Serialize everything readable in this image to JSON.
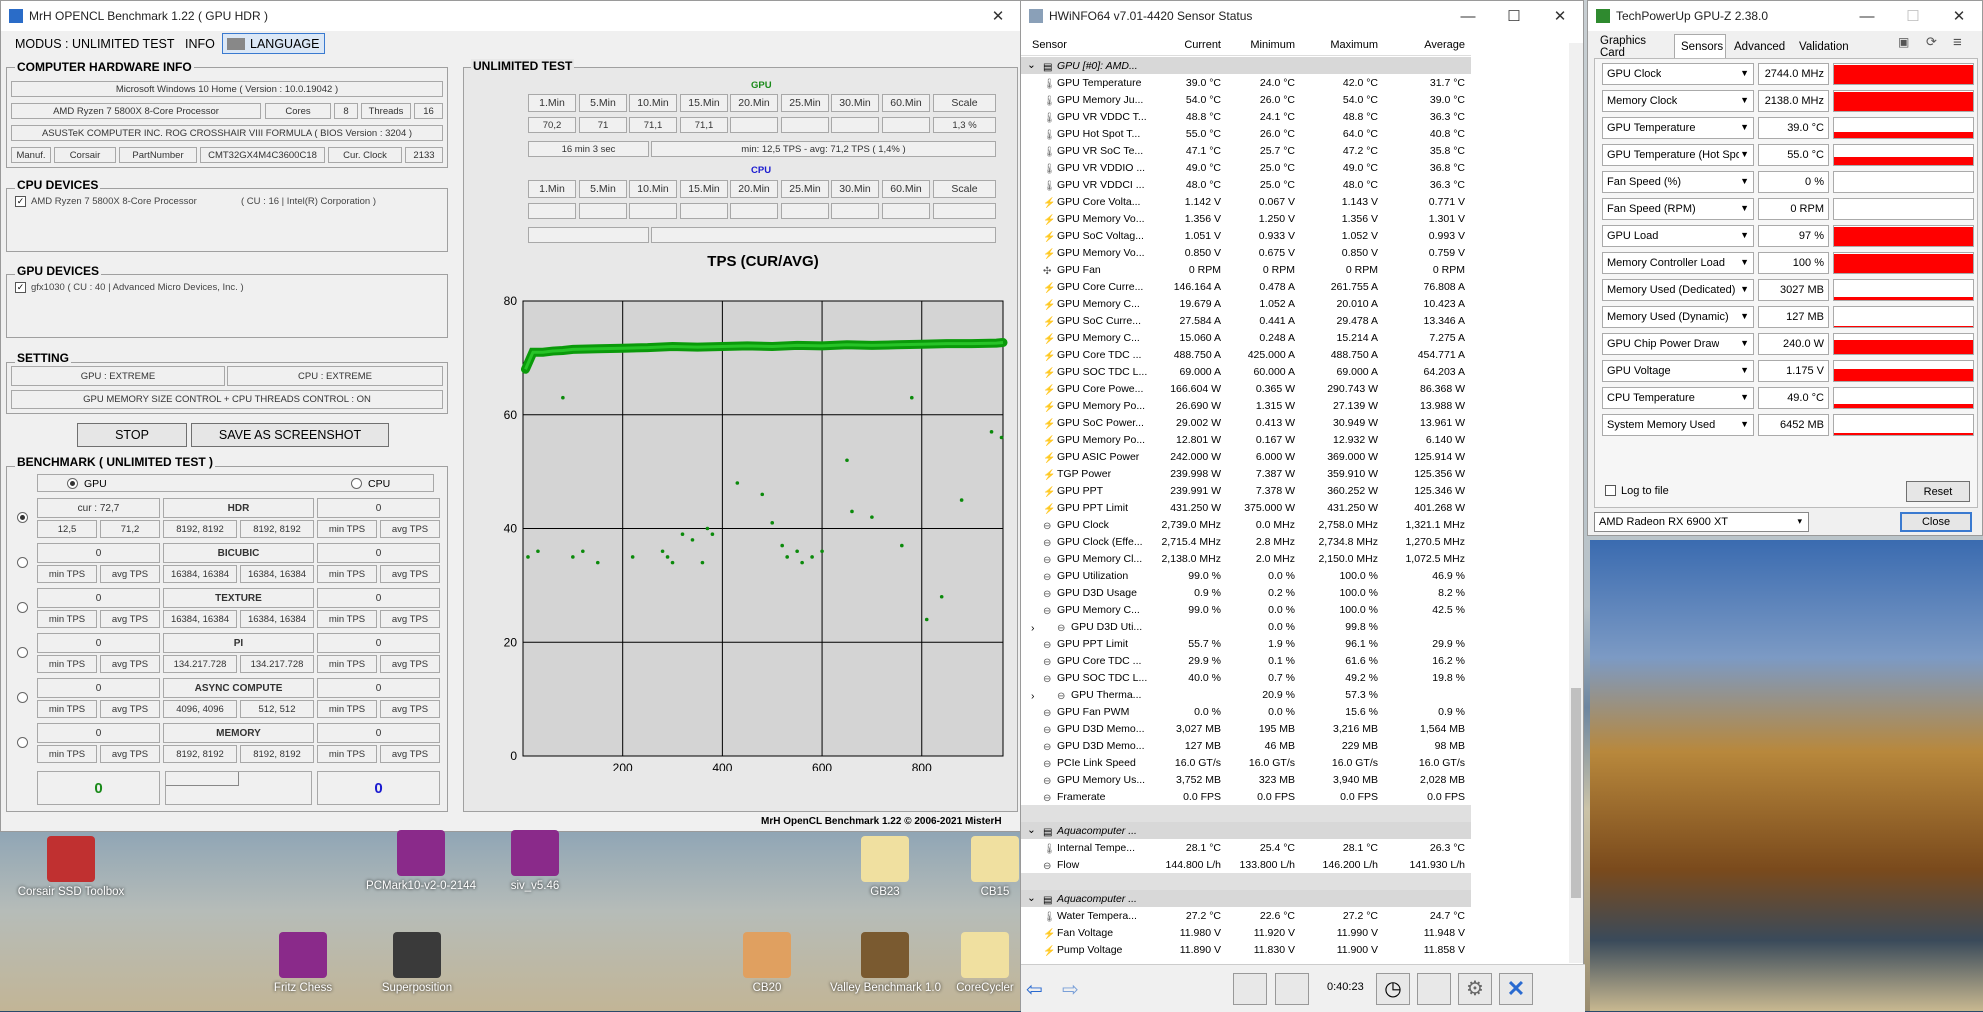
{
  "mrh": {
    "title": "MrH OPENCL Benchmark 1.22 ( GPU HDR )",
    "menu": {
      "modus": "MODUS : UNLIMITED TEST",
      "info": "INFO",
      "language": "LANGUAGE"
    },
    "hw_info": {
      "title": "COMPUTER HARDWARE INFO",
      "os": "Microsoft Windows 10 Home ( Version : 10.0.19042 )",
      "cpu": "AMD Ryzen 7 5800X 8-Core Processor",
      "cores_label": "Cores",
      "cores": "8",
      "threads_label": "Threads",
      "threads": "16",
      "board": "ASUSTeK COMPUTER INC. ROG CROSSHAIR VIII FORMULA ( BIOS Version : 3204 )",
      "manuf_label": "Manuf.",
      "manuf": "Corsair",
      "part_label": "PartNumber",
      "part": "CMT32GX4M4C3600C18",
      "clock_label": "Cur. Clock",
      "clock": "2133"
    },
    "cpu_devices": {
      "title": "CPU DEVICES",
      "item": "AMD Ryzen 7 5800X 8-Core Processor",
      "item2": "( CU : 16 | Intel(R) Corporation )"
    },
    "gpu_devices": {
      "title": "GPU DEVICES",
      "item": "gfx1030 ( CU : 40 | Advanced Micro Devices, Inc. )"
    },
    "setting": {
      "title": "SETTING",
      "gpu": "GPU : EXTREME",
      "cpu": "CPU : EXTREME",
      "control": "GPU MEMORY SIZE CONTROL + CPU THREADS CONTROL : ON"
    },
    "stop": "STOP",
    "save": "SAVE AS SCREENSHOT",
    "benchmark": {
      "title": "BENCHMARK ( UNLIMITED TEST )",
      "gpu": "GPU",
      "cpu": "CPU",
      "rows": [
        {
          "left": "cur : 72,7",
          "l1": "12,5",
          "l2": "71,2",
          "name": "HDR",
          "c1": "8192, 8192",
          "c2": "8192, 8192",
          "right": "0",
          "r1": "min TPS",
          "r2": "avg TPS"
        },
        {
          "left": "0",
          "l1": "min TPS",
          "l2": "avg TPS",
          "name": "BICUBIC",
          "c1": "16384, 16384",
          "c2": "16384, 16384",
          "right": "0",
          "r1": "min TPS",
          "r2": "avg TPS"
        },
        {
          "left": "0",
          "l1": "min TPS",
          "l2": "avg TPS",
          "name": "TEXTURE",
          "c1": "16384, 16384",
          "c2": "16384, 16384",
          "right": "0",
          "r1": "min TPS",
          "r2": "avg TPS"
        },
        {
          "left": "0",
          "l1": "min TPS",
          "l2": "avg TPS",
          "name": "PI",
          "c1": "134.217.728",
          "c2": "134.217.728",
          "right": "0",
          "r1": "min TPS",
          "r2": "avg TPS"
        },
        {
          "left": "0",
          "l1": "min TPS",
          "l2": "avg TPS",
          "name": "ASYNC COMPUTE",
          "c1": "4096, 4096",
          "c2": "512, 512",
          "right": "0",
          "r1": "min TPS",
          "r2": "avg TPS"
        },
        {
          "left": "0",
          "l1": "min TPS",
          "l2": "avg TPS",
          "name": "MEMORY",
          "c1": "8192, 8192",
          "c2": "8192, 8192",
          "right": "0",
          "r1": "min TPS",
          "r2": "avg TPS"
        }
      ],
      "score_gpu": "0",
      "score_cpu": "0"
    },
    "unlimited": {
      "title": "UNLIMITED TEST",
      "gpu_label": "GPU",
      "cpu_label": "CPU",
      "cols": [
        "1.Min",
        "5.Min",
        "10.Min",
        "15.Min",
        "20.Min",
        "25.Min",
        "30.Min",
        "60.Min",
        "Scale"
      ],
      "gpu_vals": [
        "70,2",
        "71",
        "71,1",
        "71,1",
        "",
        "",
        "",
        "",
        "1,3 %"
      ],
      "gpu_time": "16 min 3 sec",
      "gpu_summary": "min: 12,5 TPS - avg: 71,2 TPS ( 1,4% )"
    },
    "footer": "MrH OpenCL Benchmark 1.22  ©  2006-2021 MisterH"
  },
  "chart_data": {
    "type": "scatter",
    "title": "TPS (CUR/AVG)",
    "ylim": [
      0,
      80
    ],
    "xlim": [
      0,
      963
    ],
    "yticks": [
      0,
      20,
      40,
      60,
      80
    ],
    "xticks": [
      200,
      400,
      600,
      800
    ],
    "grid": true,
    "series": [
      {
        "values_note": "",
        "x": [
          5,
          20,
          40,
          60,
          80,
          100,
          150,
          200,
          250,
          300,
          350,
          400,
          450,
          500,
          550,
          600,
          650,
          700,
          750,
          800,
          850,
          900,
          950,
          963
        ],
        "y": [
          68,
          71,
          71,
          71.2,
          71.3,
          71.5,
          71.6,
          71.7,
          71.8,
          72,
          71.9,
          72,
          72.1,
          72,
          72.2,
          72.1,
          72.3,
          72.2,
          72.3,
          72.4,
          72.5,
          72.5,
          72.6,
          72.7
        ]
      },
      {
        "x": [
          10,
          30,
          80,
          100,
          120,
          150,
          220,
          280,
          290,
          300,
          320,
          340,
          360,
          370,
          380,
          430,
          480,
          500,
          520,
          530,
          550,
          560,
          580,
          600,
          650,
          660,
          700,
          760,
          780,
          810,
          840,
          880,
          940,
          960
        ],
        "y": [
          35,
          36,
          63,
          35,
          36,
          34,
          35,
          36,
          35,
          34,
          39,
          38,
          34,
          40,
          39,
          48,
          46,
          41,
          37,
          35,
          36,
          34,
          35,
          36,
          52,
          43,
          42,
          37,
          63,
          24,
          28,
          45,
          57,
          56
        ]
      }
    ]
  },
  "hwinfo": {
    "title": "HWiNFO64 v7.01-4420 Sensor Status",
    "headers": [
      "Sensor",
      "Current",
      "Minimum",
      "Maximum",
      "Average"
    ],
    "rows": [
      {
        "t": "section",
        "n": "GPU [#0]: AMD..."
      },
      {
        "i": "temp",
        "n": "GPU Temperature",
        "c": "39.0 °C",
        "mn": "24.0 °C",
        "mx": "42.0 °C",
        "a": "31.7 °C"
      },
      {
        "i": "temp",
        "n": "GPU Memory Ju...",
        "c": "54.0 °C",
        "mn": "26.0 °C",
        "mx": "54.0 °C",
        "a": "39.0 °C"
      },
      {
        "i": "temp",
        "n": "GPU VR VDDC T...",
        "c": "48.8 °C",
        "mn": "24.1 °C",
        "mx": "48.8 °C",
        "a": "36.3 °C"
      },
      {
        "i": "temp",
        "n": "GPU Hot Spot T...",
        "c": "55.0 °C",
        "mn": "26.0 °C",
        "mx": "64.0 °C",
        "a": "40.8 °C"
      },
      {
        "i": "temp",
        "n": "GPU VR SoC Te...",
        "c": "47.1 °C",
        "mn": "25.7 °C",
        "mx": "47.2 °C",
        "a": "35.8 °C"
      },
      {
        "i": "temp",
        "n": "GPU VR VDDIO ...",
        "c": "49.0 °C",
        "mn": "25.0 °C",
        "mx": "49.0 °C",
        "a": "36.8 °C"
      },
      {
        "i": "temp",
        "n": "GPU VR VDDCI ...",
        "c": "48.0 °C",
        "mn": "25.0 °C",
        "mx": "48.0 °C",
        "a": "36.3 °C"
      },
      {
        "i": "volt",
        "n": "GPU Core Volta...",
        "c": "1.142 V",
        "mn": "0.067 V",
        "mx": "1.143 V",
        "a": "0.771 V"
      },
      {
        "i": "volt",
        "n": "GPU Memory Vo...",
        "c": "1.356 V",
        "mn": "1.250 V",
        "mx": "1.356 V",
        "a": "1.301 V"
      },
      {
        "i": "volt",
        "n": "GPU SoC Voltag...",
        "c": "1.051 V",
        "mn": "0.933 V",
        "mx": "1.052 V",
        "a": "0.993 V"
      },
      {
        "i": "volt",
        "n": "GPU Memory Vo...",
        "c": "0.850 V",
        "mn": "0.675 V",
        "mx": "0.850 V",
        "a": "0.759 V"
      },
      {
        "i": "fan",
        "n": "GPU Fan",
        "c": "0 RPM",
        "mn": "0 RPM",
        "mx": "0 RPM",
        "a": "0 RPM"
      },
      {
        "i": "volt",
        "n": "GPU Core Curre...",
        "c": "146.164 A",
        "mn": "0.478 A",
        "mx": "261.755 A",
        "a": "76.808 A"
      },
      {
        "i": "volt",
        "n": "GPU Memory C...",
        "c": "19.679 A",
        "mn": "1.052 A",
        "mx": "20.010 A",
        "a": "10.423 A"
      },
      {
        "i": "volt",
        "n": "GPU SoC Curre...",
        "c": "27.584 A",
        "mn": "0.441 A",
        "mx": "29.478 A",
        "a": "13.346 A"
      },
      {
        "i": "volt",
        "n": "GPU Memory C...",
        "c": "15.060 A",
        "mn": "0.248 A",
        "mx": "15.214 A",
        "a": "7.275 A"
      },
      {
        "i": "volt",
        "n": "GPU Core TDC ...",
        "c": "488.750 A",
        "mn": "425.000 A",
        "mx": "488.750 A",
        "a": "454.771 A"
      },
      {
        "i": "volt",
        "n": "GPU SOC TDC L...",
        "c": "69.000 A",
        "mn": "60.000 A",
        "mx": "69.000 A",
        "a": "64.203 A"
      },
      {
        "i": "volt",
        "n": "GPU Core Powe...",
        "c": "166.604 W",
        "mn": "0.365 W",
        "mx": "290.743 W",
        "a": "86.368 W"
      },
      {
        "i": "volt",
        "n": "GPU Memory Po...",
        "c": "26.690 W",
        "mn": "1.315 W",
        "mx": "27.139 W",
        "a": "13.988 W"
      },
      {
        "i": "volt",
        "n": "GPU SoC Power...",
        "c": "29.002 W",
        "mn": "0.413 W",
        "mx": "30.949 W",
        "a": "13.961 W"
      },
      {
        "i": "volt",
        "n": "GPU Memory Po...",
        "c": "12.801 W",
        "mn": "0.167 W",
        "mx": "12.932 W",
        "a": "6.140 W"
      },
      {
        "i": "volt",
        "n": "GPU ASIC Power",
        "c": "242.000 W",
        "mn": "6.000 W",
        "mx": "369.000 W",
        "a": "125.914 W"
      },
      {
        "i": "volt",
        "n": "TGP Power",
        "c": "239.998 W",
        "mn": "7.387 W",
        "mx": "359.910 W",
        "a": "125.356 W"
      },
      {
        "i": "volt",
        "n": "GPU PPT",
        "c": "239.991 W",
        "mn": "7.378 W",
        "mx": "360.252 W",
        "a": "125.346 W"
      },
      {
        "i": "volt",
        "n": "GPU PPT Limit",
        "c": "431.250 W",
        "mn": "375.000 W",
        "mx": "431.250 W",
        "a": "401.268 W"
      },
      {
        "i": "clock",
        "n": "GPU Clock",
        "c": "2,739.0 MHz",
        "mn": "0.0 MHz",
        "mx": "2,758.0 MHz",
        "a": "1,321.1 MHz"
      },
      {
        "i": "clock",
        "n": "GPU Clock (Effe...",
        "c": "2,715.4 MHz",
        "mn": "2.8 MHz",
        "mx": "2,734.8 MHz",
        "a": "1,270.5 MHz"
      },
      {
        "i": "clock",
        "n": "GPU Memory Cl...",
        "c": "2,138.0 MHz",
        "mn": "2.0 MHz",
        "mx": "2,150.0 MHz",
        "a": "1,072.5 MHz"
      },
      {
        "i": "clock",
        "n": "GPU Utilization",
        "c": "99.0 %",
        "mn": "0.0 %",
        "mx": "100.0 %",
        "a": "46.9 %"
      },
      {
        "i": "clock",
        "n": "GPU D3D Usage",
        "c": "0.9 %",
        "mn": "0.2 %",
        "mx": "100.0 %",
        "a": "8.2 %"
      },
      {
        "i": "clock",
        "n": "GPU Memory C...",
        "c": "99.0 %",
        "mn": "0.0 %",
        "mx": "100.0 %",
        "a": "42.5 %"
      },
      {
        "i": "clock",
        "n": "GPU D3D Uti...",
        "c": "",
        "mn": "0.0 %",
        "mx": "99.8 %",
        "a": "",
        "x": "expand"
      },
      {
        "i": "clock",
        "n": "GPU PPT Limit",
        "c": "55.7 %",
        "mn": "1.9 %",
        "mx": "96.1 %",
        "a": "29.9 %"
      },
      {
        "i": "clock",
        "n": "GPU Core TDC ...",
        "c": "29.9 %",
        "mn": "0.1 %",
        "mx": "61.6 %",
        "a": "16.2 %"
      },
      {
        "i": "clock",
        "n": "GPU SOC TDC L...",
        "c": "40.0 %",
        "mn": "0.7 %",
        "mx": "49.2 %",
        "a": "19.8 %"
      },
      {
        "i": "clock",
        "n": "GPU Therma...",
        "c": "",
        "mn": "20.9 %",
        "mx": "57.3 %",
        "a": "",
        "x": "expand"
      },
      {
        "i": "clock",
        "n": "GPU Fan PWM",
        "c": "0.0 %",
        "mn": "0.0 %",
        "mx": "15.6 %",
        "a": "0.9 %"
      },
      {
        "i": "mem",
        "n": "GPU D3D Memo...",
        "c": "3,027 MB",
        "mn": "195 MB",
        "mx": "3,216 MB",
        "a": "1,564 MB"
      },
      {
        "i": "mem",
        "n": "GPU D3D Memo...",
        "c": "127 MB",
        "mn": "46 MB",
        "mx": "229 MB",
        "a": "98 MB"
      },
      {
        "i": "mem",
        "n": "PCIe Link Speed",
        "c": "16.0 GT/s",
        "mn": "16.0 GT/s",
        "mx": "16.0 GT/s",
        "a": "16.0 GT/s"
      },
      {
        "i": "mem",
        "n": "GPU Memory Us...",
        "c": "3,752 MB",
        "mn": "323 MB",
        "mx": "3,940 MB",
        "a": "2,028 MB"
      },
      {
        "i": "mem",
        "n": "Framerate",
        "c": "0.0 FPS",
        "mn": "0.0 FPS",
        "mx": "0.0 FPS",
        "a": "0.0 FPS"
      },
      {
        "t": "blank"
      },
      {
        "t": "section",
        "n": "Aquacomputer ..."
      },
      {
        "i": "temp",
        "n": "Internal Tempe...",
        "c": "28.1 °C",
        "mn": "25.4 °C",
        "mx": "28.1 °C",
        "a": "26.3 °C"
      },
      {
        "i": "clock",
        "n": "Flow",
        "c": "144.800 L/h",
        "mn": "133.800 L/h",
        "mx": "146.200 L/h",
        "a": "141.930 L/h"
      },
      {
        "t": "blank"
      },
      {
        "t": "section",
        "n": "Aquacomputer ..."
      },
      {
        "i": "temp",
        "n": "Water Tempera...",
        "c": "27.2 °C",
        "mn": "22.6 °C",
        "mx": "27.2 °C",
        "a": "24.7 °C"
      },
      {
        "i": "volt",
        "n": "Fan Voltage",
        "c": "11.980 V",
        "mn": "11.920 V",
        "mx": "11.990 V",
        "a": "11.948 V"
      },
      {
        "i": "volt",
        "n": "Pump Voltage",
        "c": "11.890 V",
        "mn": "11.830 V",
        "mx": "11.900 V",
        "a": "11.858 V"
      }
    ],
    "timer": "0:40:23"
  },
  "gpuz": {
    "title": "TechPowerUp GPU-Z 2.38.0",
    "tabs": [
      "Graphics Card",
      "Sensors",
      "Advanced",
      "Validation"
    ],
    "rows": [
      {
        "n": "GPU Clock",
        "v": "2744.0 MHz",
        "f": 0.95
      },
      {
        "n": "Memory Clock",
        "v": "2138.0 MHz",
        "f": 0.95
      },
      {
        "n": "GPU Temperature",
        "v": "39.0 °C",
        "f": 0.3
      },
      {
        "n": "GPU Temperature (Hot Spot)",
        "v": "55.0 °C",
        "f": 0.4
      },
      {
        "n": "Fan Speed (%)",
        "v": "0 %",
        "f": 0
      },
      {
        "n": "Fan Speed (RPM)",
        "v": "0 RPM",
        "f": 0
      },
      {
        "n": "GPU Load",
        "v": "97 %",
        "f": 0.95
      },
      {
        "n": "Memory Controller Load",
        "v": "100 %",
        "f": 0.95
      },
      {
        "n": "Memory Used (Dedicated)",
        "v": "3027 MB",
        "f": 0.15
      },
      {
        "n": "Memory Used (Dynamic)",
        "v": "127 MB",
        "f": 0.05
      },
      {
        "n": "GPU Chip Power Draw",
        "v": "240.0 W",
        "f": 0.7
      },
      {
        "n": "GPU Voltage",
        "v": "1.175 V",
        "f": 0.6
      },
      {
        "n": "CPU Temperature",
        "v": "49.0 °C",
        "f": 0.2
      },
      {
        "n": "System Memory Used",
        "v": "6452 MB",
        "f": 0.1
      }
    ],
    "log": "Log to file",
    "reset": "Reset",
    "device": "AMD Radeon RX 6900 XT",
    "close": "Close"
  },
  "desktop": {
    "icons": [
      {
        "label": "Corsair SSD Toolbox"
      },
      {
        "label": "PCMark10-v2-0-2144"
      },
      {
        "label": "siv_v5.46"
      },
      {
        "label": "GB23"
      },
      {
        "label": "CB15"
      },
      {
        "label": "Fritz Chess"
      },
      {
        "label": "Superposition"
      },
      {
        "label": "CB20"
      },
      {
        "label": "Valley Benchmark 1.0"
      },
      {
        "label": "CoreCycler"
      }
    ]
  }
}
